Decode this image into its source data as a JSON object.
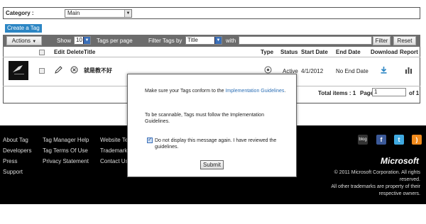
{
  "category": {
    "label": "Category :",
    "selected": "Main"
  },
  "create_tag_label": "Create a Tag",
  "toolbar": {
    "actions_label": "Actions",
    "show_label": "Show",
    "show_value": "10",
    "per_page_label": "Tags per page",
    "filter_label": "Filter Tags by",
    "filter_value": "Title",
    "with_label": "with",
    "filter_input_value": "",
    "filter_button": "Filter",
    "reset_button": "Reset"
  },
  "table": {
    "headers": {
      "edit": "Edit",
      "delete": "Delete",
      "title": "Title",
      "type": "Type",
      "status": "Status",
      "start_date": "Start Date",
      "end_date": "End Date",
      "download": "Download",
      "report": "Report"
    },
    "rows": [
      {
        "title": "就是教不好",
        "status": "Active",
        "start_date": "4/1/2012",
        "end_date": "No End Date"
      }
    ],
    "total_items_label": "Total items : 1",
    "page_label": "Page",
    "page_value": "1",
    "page_of": "of 1"
  },
  "footer": {
    "col1": [
      "About Tag",
      "Developers",
      "Press",
      "Support"
    ],
    "col2": [
      "Tag Manager Help",
      "Tag Terms Of Use",
      "Privacy Statement"
    ],
    "col3": [
      "Website Terms",
      "Trademarks",
      "Contact Us"
    ],
    "social_blog_label": "blog",
    "brand": "Microsoft",
    "copyright_lines": [
      "© 2011 Microsoft Corporation. All rights",
      "reserved.",
      "All other trademarks are property of their",
      "respective owners."
    ]
  },
  "modal": {
    "line1_prefix": "Make sure your Tags conform to the ",
    "line1_link": "Implementation Guidelines",
    "line1_suffix": ".",
    "line2": "To be scannable, Tags must follow the Implementation Guidelines.",
    "checkbox_label": "Do not display this message again. I have reviewed the guidelines.",
    "checkbox_checked": true,
    "submit_label": "Submit"
  },
  "colors": {
    "accent": "#2c86c4",
    "toolbar": "#6c6c6c",
    "footer_bg": "#000000",
    "download_icon": "#2c86c4"
  }
}
